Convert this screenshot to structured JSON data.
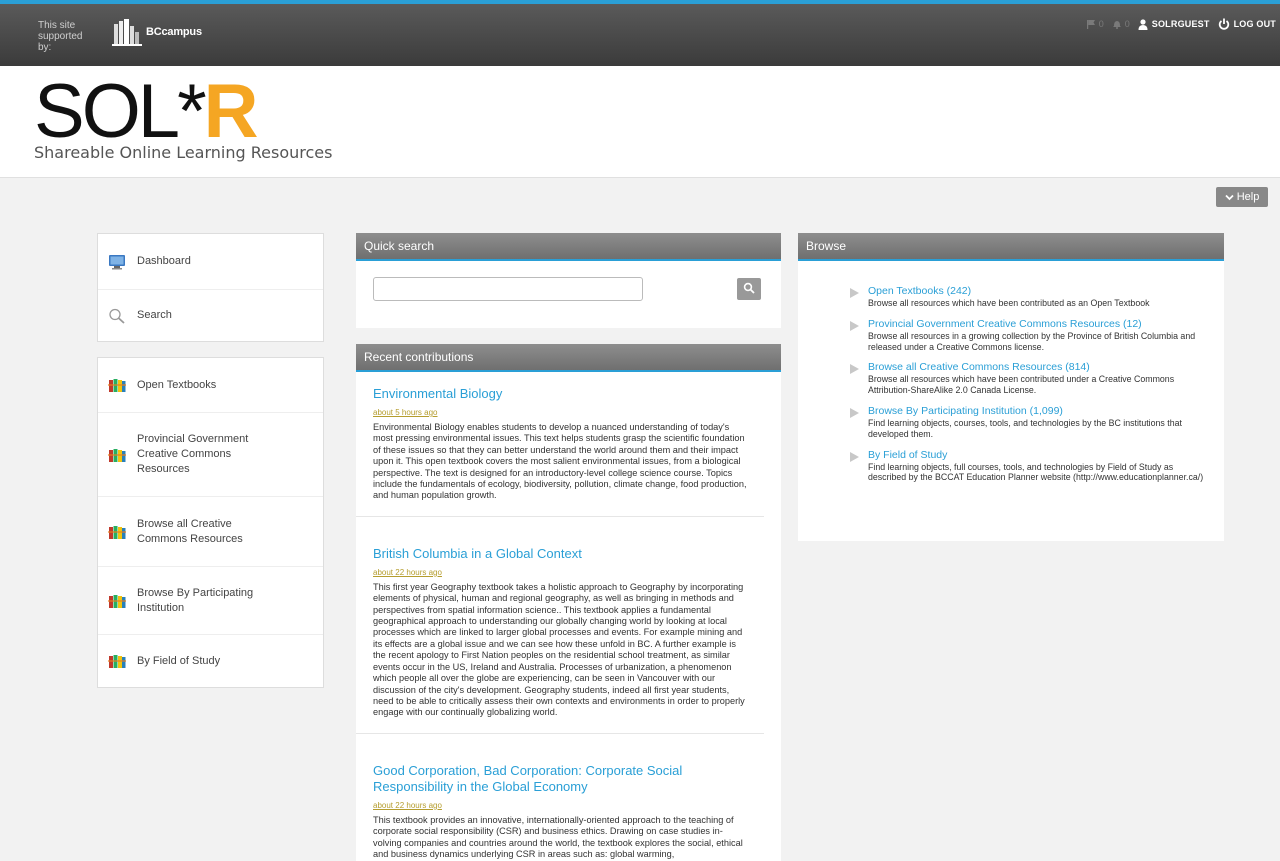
{
  "topbar": {
    "supported_text": "This site supported by:",
    "partner_name": "BCcampus",
    "messages_count": "0",
    "notifications_count": "0",
    "username": "SOLRGUEST",
    "logout_label": "LOG OUT"
  },
  "logo": {
    "main": "SOL*",
    "accent": "R",
    "subtitle": "Shareable Online Learning Resources"
  },
  "help_label": "Help",
  "nav_primary": [
    {
      "label": "Dashboard",
      "icon": "monitor-icon"
    },
    {
      "label": "Search",
      "icon": "magnifier-icon"
    }
  ],
  "nav_secondary": [
    {
      "label": "Open Textbooks",
      "icon": "books-icon"
    },
    {
      "label": "Provincial Government Creative Commons Resources",
      "icon": "books-icon"
    },
    {
      "label": "Browse all Creative Commons Resources",
      "icon": "books-icon"
    },
    {
      "label": "Browse By Participating Institution",
      "icon": "books-icon"
    },
    {
      "label": "By Field of Study",
      "icon": "books-icon"
    }
  ],
  "quick_search": {
    "title": "Quick search",
    "placeholder": ""
  },
  "recent": {
    "title": "Recent contributions",
    "entries": [
      {
        "title": "Environmental Biology",
        "time": "about 5 hours ago",
        "text": "Environmental Biology enables students to develop a nuanced understanding of today's most pressing environmental issues. This text helps students grasp the scientific foundation of these issues so that they can better understand the world around them and their impact upon it. This open textbook covers the most salient environmental issues, from a biological perspective. The text is designed for an introductory-level college science course. Topics include the fundamentals of ecology, biodiversity, pollution, climate change, food production, and human population growth."
      },
      {
        "title": "British Columbia in a Global Context",
        "time": "about 22 hours ago",
        "text": "This first year Geography textbook takes a holistic approach to Geography by incorporating elements of physical, human and regional geography, as well as bringing in methods and perspectives from spatial information science.. This textbook applies a fundamental geographical approach to understanding our globally changing world by looking at local processes which are linked to larger global processes and events. For example mining and its effects are a global issue and we can see how these unfold in BC. A further example is the recent apology to First Nation peoples on the residential school treatment, as similar events occur in the US, Ireland and Australia. Processes of urbanization, a phenomenon which people all over the globe are experiencing, can be seen in Vancouver with our discussion of the city's development. Geography students, indeed all first year students, need to be able to critically assess their own contexts and environments in order to properly engage with our continually globalizing world."
      },
      {
        "title": "Good Corporation, Bad Corporation: Corporate Social Responsibility in the Global Economy",
        "time": "about 22 hours ago",
        "text": "This textbook provides an innovative, internationally-oriented approach to the teaching of corporate social responsibility (CSR) and business ethics. Drawing on case studies in- volving companies and countries around the world, the textbook explores the social, ethical and business dynamics underlying CSR in areas such as: global warming,"
      }
    ]
  },
  "browse": {
    "title": "Browse",
    "items": [
      {
        "title": "Open Textbooks (242)",
        "desc": "Browse all resources which have been contributed as an Open Textbook"
      },
      {
        "title": "Provincial Government Creative Commons Resources (12)",
        "desc": "Browse all resources in a growing collection by the Province of British Columbia and released under a Creative Commons license."
      },
      {
        "title": "Browse all Creative Commons Resources (814)",
        "desc": "Browse all resources which have been contributed under a Creative Commons Attribution-ShareAlike 2.0 Canada License."
      },
      {
        "title": "Browse By Participating Institution (1,099)",
        "desc": "Find learning objects, courses, tools, and technologies by the BC institutions that developed them."
      },
      {
        "title": "By Field of Study",
        "desc": "Find learning objects, full courses, tools, and technologies by Field of Study as described by the BCCAT Education Planner website (http://www.educationplanner.ca/)"
      }
    ]
  }
}
